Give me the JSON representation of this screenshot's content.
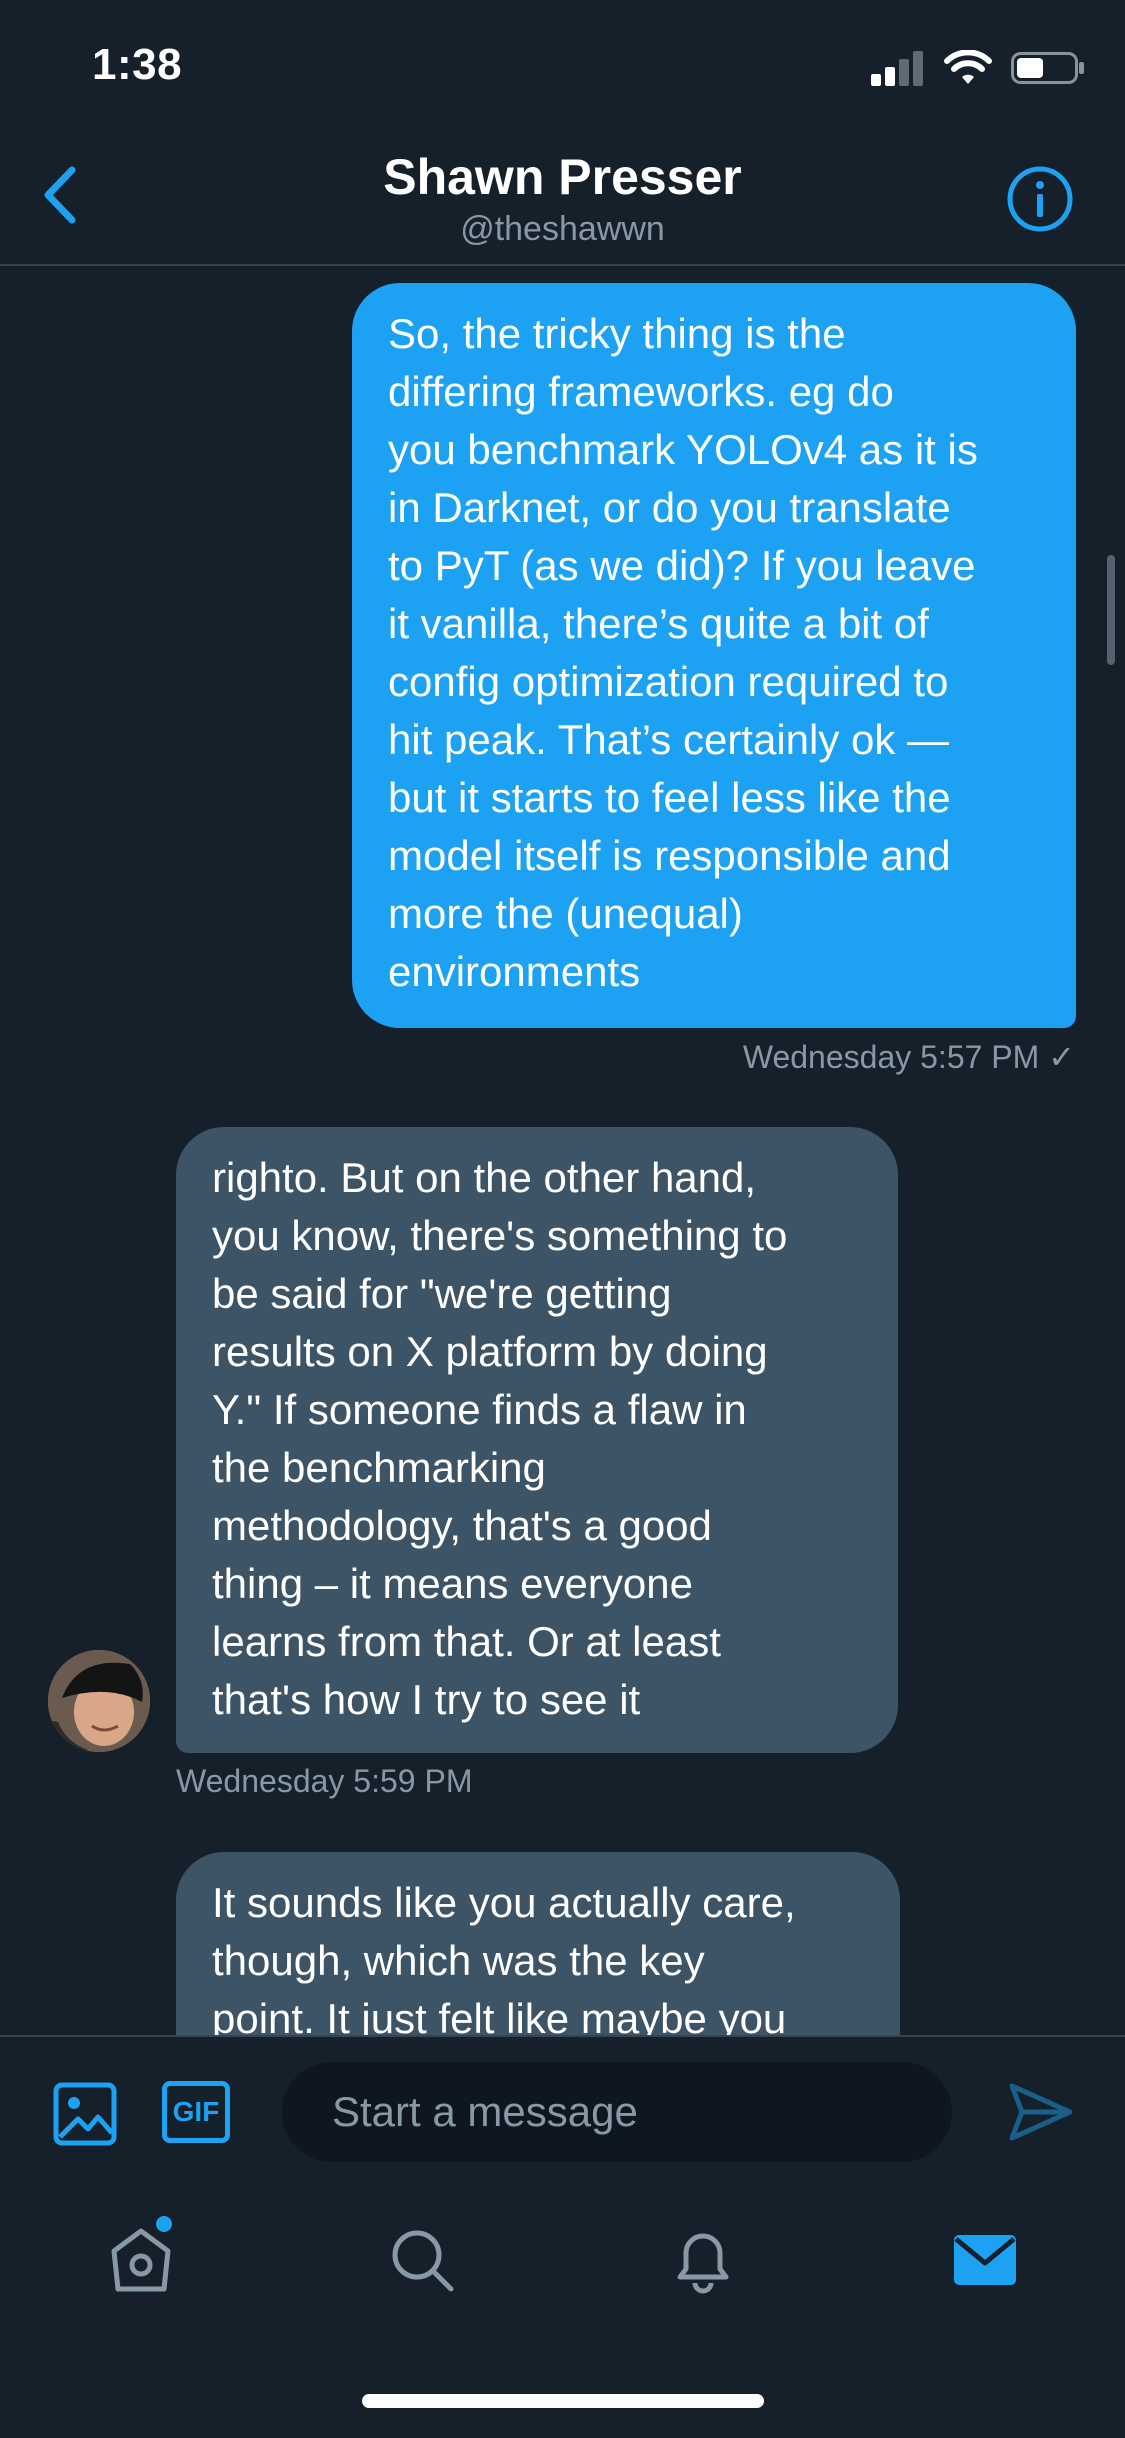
{
  "status_bar": {
    "time": "1:38",
    "icons": [
      "signal-icon",
      "wifi-icon",
      "battery-icon"
    ]
  },
  "header": {
    "name": "Shawn Presser",
    "handle": "@theshawwn",
    "back_icon": "chevron-left-icon",
    "info_icon": "info-icon"
  },
  "messages": [
    {
      "direction": "outgoing",
      "lines": [
        "So, the tricky thing is the",
        "differing frameworks. eg do",
        "you benchmark YOLOv4 as it is",
        "in Darknet, or do you translate",
        "to PyT (as we did)? If you leave",
        "it vanilla, there’s quite a bit of",
        "config optimization required to",
        "hit peak. That’s certainly ok —",
        "but it starts to feel less like the",
        "model itself is responsible and",
        "more the (unequal)",
        "environments"
      ],
      "timestamp": "Wednesday 5:57 PM ✓"
    },
    {
      "direction": "incoming",
      "lines": [
        "righto. But on the other hand,",
        "you know, there's something to",
        "be said for \"we're getting",
        "results on X platform by doing",
        "Y.\" If someone finds a flaw in",
        "the benchmarking",
        "methodology, that's a good",
        "thing – it means everyone",
        "learns from that. Or at least",
        "that's how I try to see it"
      ],
      "timestamp": "Wednesday 5:59 PM"
    },
    {
      "direction": "incoming",
      "lines": [
        "It sounds like you actually care,",
        "though, which was the key",
        "point. It just felt like maybe you"
      ]
    }
  ],
  "composer": {
    "placeholder": "Start a message",
    "gif_label": "GIF",
    "media_icon": "image-icon",
    "send_icon": "send-icon"
  },
  "tab_bar": {
    "items": [
      "home-icon",
      "search-icon",
      "bell-icon",
      "mail-icon"
    ],
    "active": "mail-icon"
  },
  "colors": {
    "background": "#15202b",
    "accent": "#1da1f2",
    "incoming_bubble": "#3d5466",
    "secondary_text": "#8899a6",
    "divider": "#38444d"
  }
}
